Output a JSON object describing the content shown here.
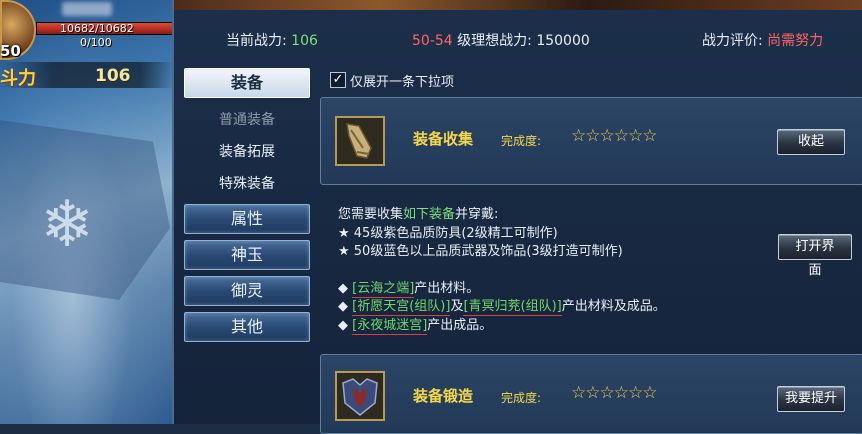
{
  "hud": {
    "level": "50",
    "hp_text": "10682/10682",
    "hp_fraction": 1.0,
    "mp_text": "0/100",
    "power_label": "斗力",
    "power_value": "106"
  },
  "stats": {
    "current_power_label": "当前战力:",
    "current_power_value": "106",
    "level_range": "50-54",
    "ideal_power_label": "级理想战力:",
    "ideal_power_value": "150000",
    "rating_label": "战力评价:",
    "rating_value": "尚需努力"
  },
  "nav": {
    "equip": "装备",
    "sub_normal": "普通装备",
    "sub_expand": "装备拓展",
    "sub_special": "特殊装备",
    "attr": "属性",
    "shenyu": "神玉",
    "yuling": "御灵",
    "other": "其他"
  },
  "checkbox": {
    "checked": true,
    "label": "仅展开一条下拉项"
  },
  "cards": [
    {
      "title": "装备收集",
      "progress_label": "完成度:",
      "stars": "☆☆☆☆☆☆",
      "star_count": 0,
      "button": "收起",
      "icon": "horn-icon"
    },
    {
      "title": "装备锻造",
      "progress_label": "完成度:",
      "stars": "☆☆☆☆☆☆",
      "star_count": 0,
      "button": "我要提升",
      "icon": "armor-icon"
    }
  ],
  "desc": {
    "intro_a": "您需要收集",
    "intro_b": "如下装备",
    "intro_c": "并穿戴:",
    "bullet_1": "★  45级紫色品质防具(2级精工可制作)",
    "bullet_2": "★  50级蓝色以上品质武器及饰品(3级打造可制作)",
    "open_button": "打开界面",
    "src1_link": "[云海之端]",
    "src1_text": "产出材料。",
    "src2_link1": "[祈愿天宫(组队)]",
    "src2_mid": "及",
    "src2_link2": "[青冥归茺(组队)]",
    "src2_text": "产出材料及成品。",
    "src3_link": "[永夜城迷宫]",
    "src3_text": "产出成品。",
    "diamond": "◆"
  },
  "colors": {
    "green": "#7de07a",
    "red": "#ff6464",
    "gold": "#ffd84a",
    "panel": "#1c2f4a"
  }
}
